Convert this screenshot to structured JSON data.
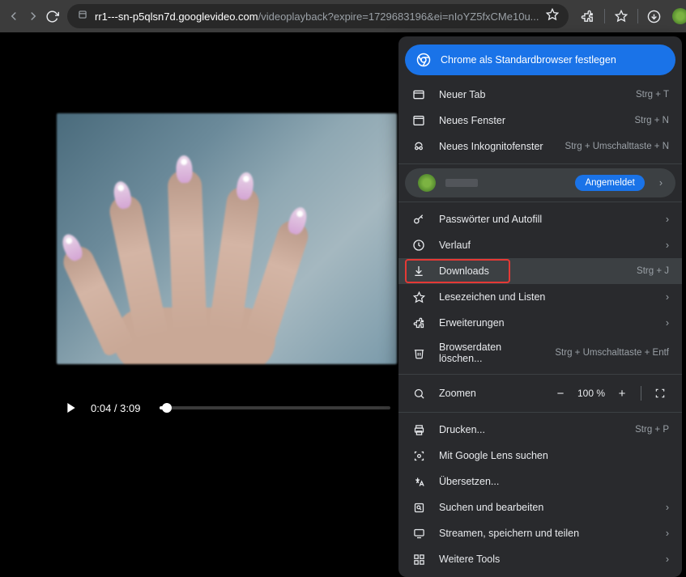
{
  "url": {
    "domain": "rr1---sn-p5qlsn7d.googlevideo.com",
    "path": "/videoplayback?expire=1729683196&ei=nIoYZ5fxCMe10u..."
  },
  "banner": {
    "text": "Chrome als Standardbrowser festlegen"
  },
  "menu": {
    "newTab": {
      "label": "Neuer Tab",
      "shortcut": "Strg + T"
    },
    "newWindow": {
      "label": "Neues Fenster",
      "shortcut": "Strg + N"
    },
    "newIncognito": {
      "label": "Neues Inkognitofenster",
      "shortcut": "Strg + Umschalttaste + N"
    },
    "profileStatus": "Angemeldet",
    "passwords": {
      "label": "Passwörter und Autofill"
    },
    "history": {
      "label": "Verlauf"
    },
    "downloads": {
      "label": "Downloads",
      "shortcut": "Strg + J"
    },
    "bookmarks": {
      "label": "Lesezeichen und Listen"
    },
    "extensions": {
      "label": "Erweiterungen"
    },
    "clearData": {
      "label": "Browserdaten löschen...",
      "shortcut": "Strg + Umschalttaste + Entf"
    },
    "zoom": {
      "label": "Zoomen",
      "value": "100 %"
    },
    "print": {
      "label": "Drucken...",
      "shortcut": "Strg + P"
    },
    "lens": {
      "label": "Mit Google Lens suchen"
    },
    "translate": {
      "label": "Übersetzen..."
    },
    "findEdit": {
      "label": "Suchen und bearbeiten"
    },
    "cast": {
      "label": "Streamen, speichern und teilen"
    },
    "moreTools": {
      "label": "Weitere Tools"
    }
  },
  "video": {
    "current": "0:04",
    "duration": "3:09"
  }
}
